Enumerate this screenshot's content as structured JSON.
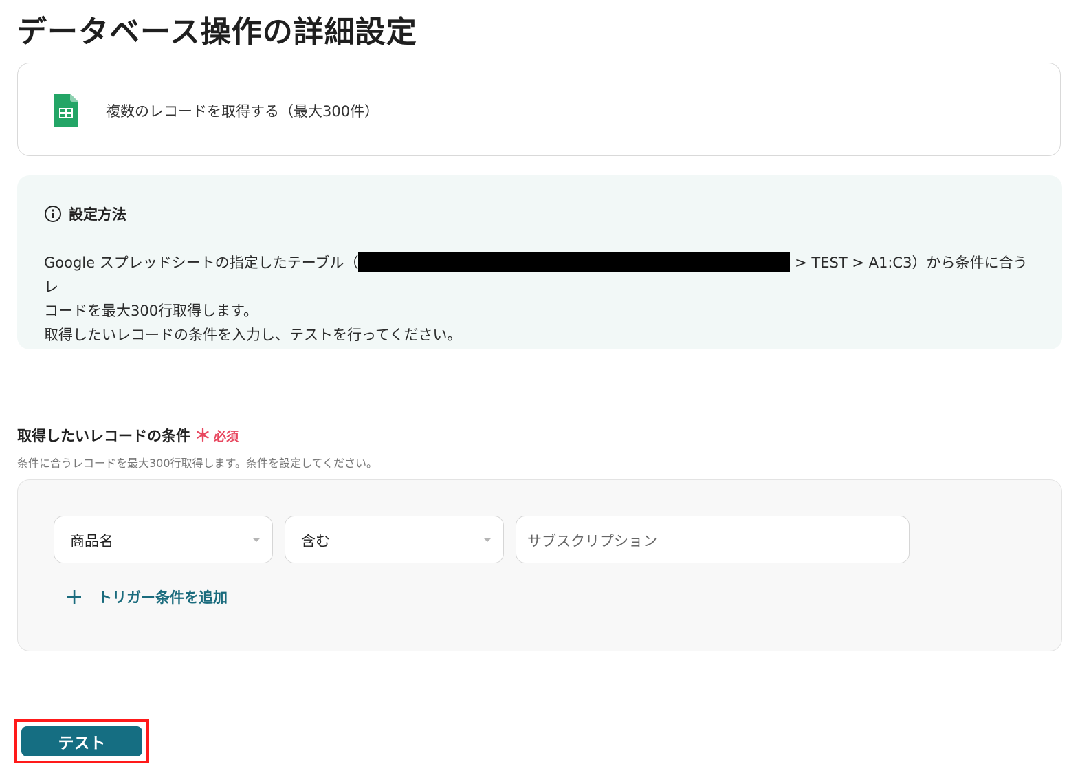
{
  "page": {
    "title": "データベース操作の詳細設定"
  },
  "action": {
    "label": "複数のレコードを取得する（最大300件）",
    "icon": "google-sheets-icon"
  },
  "info": {
    "title": "設定方法",
    "line1_prefix": "Google スプレッドシートの指定したテーブル（",
    "line1_suffix": " > TEST > A1:C3）から条件に合うレ",
    "line2": "コードを最大300行取得します。",
    "line3": "取得したいレコードの条件を入力し、テストを行ってください。"
  },
  "conditions": {
    "label": "取得したいレコードの条件",
    "required_mark": "＊",
    "required_text": "必須",
    "help": "条件に合うレコードを最大300行取得します。条件を設定してください。",
    "field_select": "商品名",
    "operator_select": "含む",
    "value_input": "サブスクリプション",
    "add_button": "トリガー条件を追加"
  },
  "test_button": {
    "label": "テスト"
  },
  "colors": {
    "accent": "#156e82",
    "link": "#1a6b7d",
    "required": "#e8475f",
    "highlight_frame": "#ff1a1a",
    "info_bg": "#f2f8f7"
  }
}
